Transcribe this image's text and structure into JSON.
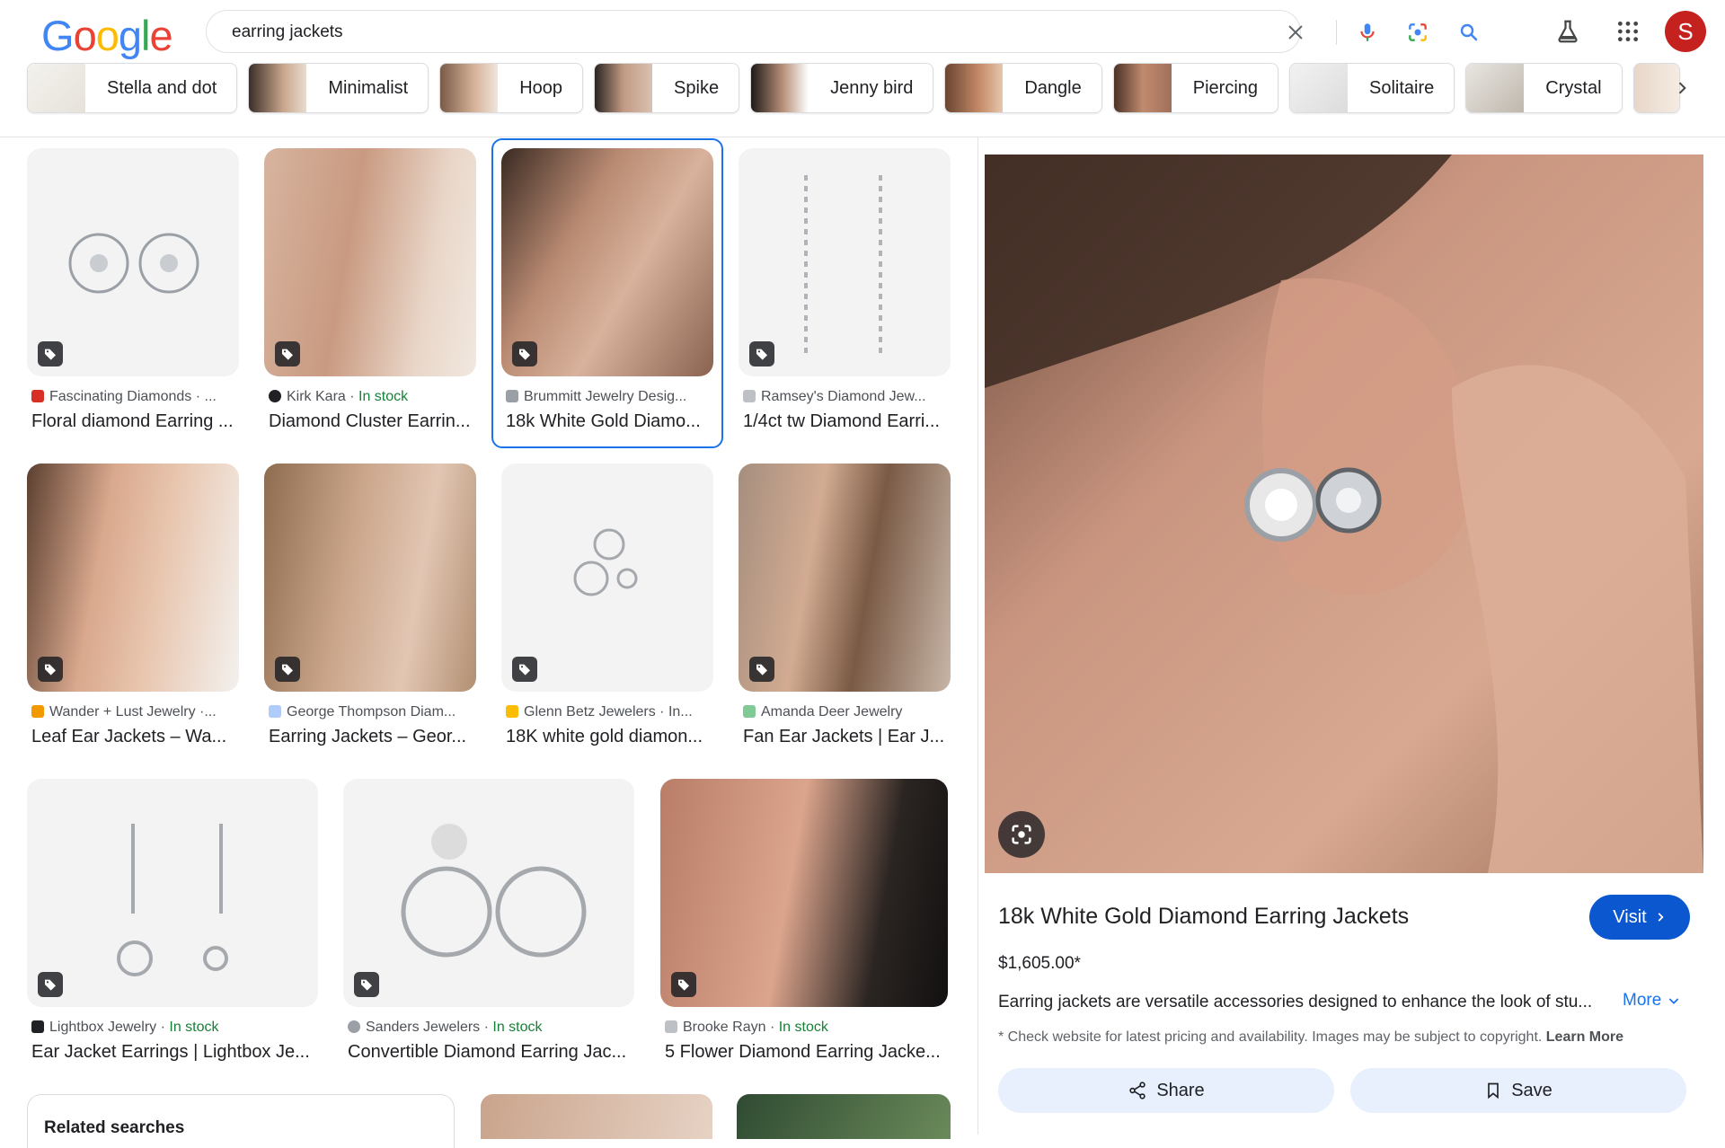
{
  "header": {
    "logo": "Google",
    "query": "earring jackets",
    "avatar_initial": "S"
  },
  "chips": [
    {
      "label": "Stella and dot"
    },
    {
      "label": "Minimalist"
    },
    {
      "label": "Hoop"
    },
    {
      "label": "Spike"
    },
    {
      "label": "Jenny bird"
    },
    {
      "label": "Dangle"
    },
    {
      "label": "Piercing"
    },
    {
      "label": "Solitaire"
    },
    {
      "label": "Crystal"
    }
  ],
  "results": [
    {
      "source": "Fascinating Diamonds · ...",
      "stock": "",
      "title": "Floral diamond Earring ..."
    },
    {
      "source": "Kirk Kara · ",
      "stock": "In stock",
      "title": "Diamond Cluster Earrin..."
    },
    {
      "source": "Brummitt Jewelry Desig...",
      "stock": "",
      "title": "18k White Gold Diamo..."
    },
    {
      "source": "Ramsey's Diamond Jew...",
      "stock": "",
      "title": "1/4ct tw Diamond Earri..."
    },
    {
      "source": "Wander + Lust Jewelry ·...",
      "stock": "",
      "title": "Leaf Ear Jackets – Wa..."
    },
    {
      "source": "George Thompson Diam...",
      "stock": "",
      "title": "Earring Jackets – Geor..."
    },
    {
      "source": "Glenn Betz Jewelers · In...",
      "stock": "",
      "title": "18K white gold diamon..."
    },
    {
      "source": "Amanda Deer Jewelry",
      "stock": "",
      "title": "Fan Ear Jackets | Ear J..."
    },
    {
      "source": "Lightbox Jewelry · ",
      "stock": "In stock",
      "title": "Ear Jacket Earrings | Lightbox Je..."
    },
    {
      "source": "Sanders Jewelers · ",
      "stock": "In stock",
      "title": "Convertible Diamond Earring Jac..."
    },
    {
      "source": "Brooke Rayn · ",
      "stock": "In stock",
      "title": "5 Flower Diamond Earring Jacke..."
    }
  ],
  "related": {
    "title": "Related searches"
  },
  "panel": {
    "title": "18k White Gold Diamond Earring Jackets",
    "visit_label": "Visit",
    "price": "$1,605.00*",
    "description": "Earring jackets are versatile accessories designed to enhance the look of stu...",
    "more_label": "More",
    "disclaimer": "* Check website for latest pricing and availability. Images may be subject to copyright.",
    "learn_more": "Learn More",
    "share_label": "Share",
    "save_label": "Save"
  },
  "colors": {
    "accent": "#1a73e8",
    "visit_bg": "#0b57d0",
    "in_stock": "#188038",
    "avatar": "#c5221f",
    "action_bg": "#e8f0fe"
  },
  "icons": [
    "clear-icon",
    "mic-icon",
    "lens-icon",
    "search-icon",
    "labs-icon",
    "apps-icon",
    "chevron-right-icon",
    "tag-icon",
    "share-icon",
    "bookmark-icon",
    "chevron-down-icon"
  ]
}
